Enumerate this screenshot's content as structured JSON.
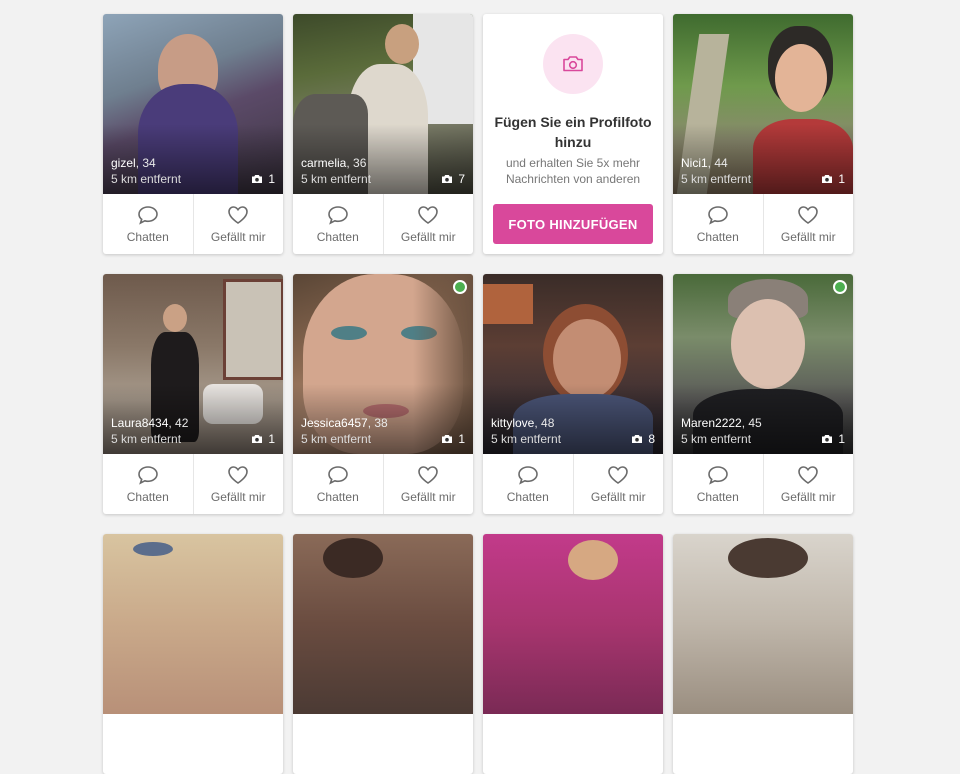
{
  "actions": {
    "chat_label": "Chatten",
    "like_label": "Gefällt mir"
  },
  "profiles": [
    {
      "name": "gizel",
      "age": ", 34",
      "distance": "5 km entfernt",
      "photos": "1",
      "online": false
    },
    {
      "name": "carmelia",
      "age": ", 36",
      "distance": "5 km entfernt",
      "photos": "7",
      "online": false
    },
    {
      "name": "Nici1",
      "age": ", 44",
      "distance": "5 km entfernt",
      "photos": "1",
      "online": false
    },
    {
      "name": "Laura8434",
      "age": ", 42",
      "distance": "5 km entfernt",
      "photos": "1",
      "online": false
    },
    {
      "name": "Jessica6457",
      "age": ", 38",
      "distance": "5 km entfernt",
      "photos": "1",
      "online": true
    },
    {
      "name": "kittylove",
      "age": ", 48",
      "distance": "5 km entfernt",
      "photos": "8",
      "online": false
    },
    {
      "name": "Maren2222",
      "age": ", 45",
      "distance": "5 km entfernt",
      "photos": "1",
      "online": true
    }
  ],
  "promo": {
    "title": "Fügen Sie ein Profilfoto hinzu",
    "subtitle": "und erhalten Sie 5x mehr Nachrichten von anderen",
    "button_label": "FOTO HINZUFÜGEN",
    "icon": "camera-icon",
    "accent": "#d9489b",
    "icon_bg": "#fbe3f1"
  },
  "colors": {
    "online": "#4caf50",
    "page_bg": "#f2f2f2"
  }
}
